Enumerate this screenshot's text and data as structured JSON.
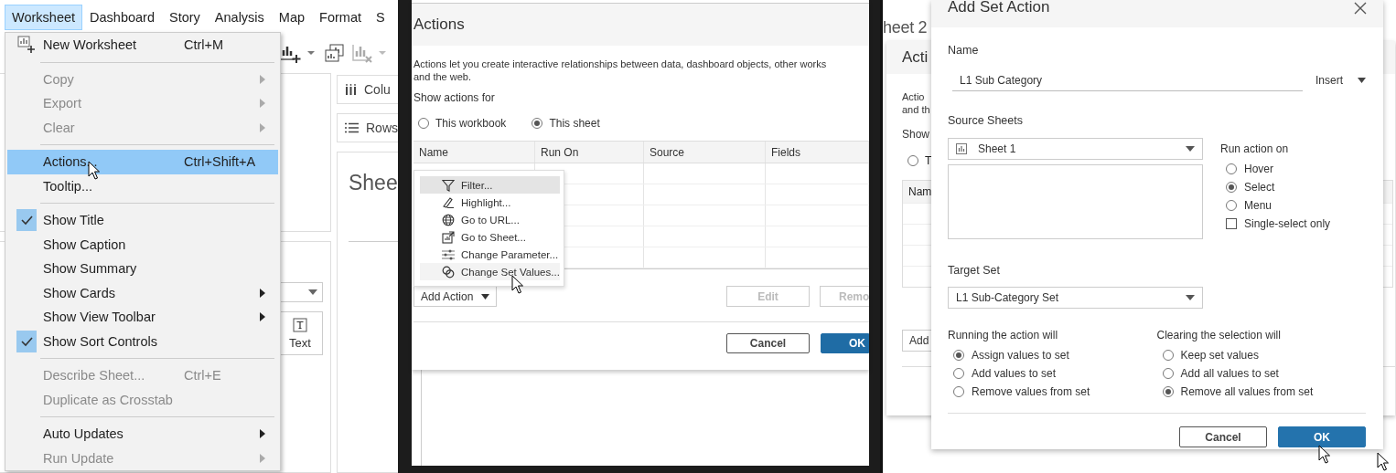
{
  "menubar": [
    {
      "label": "Worksheet",
      "selected": true
    },
    {
      "label": "Dashboard",
      "selected": false
    },
    {
      "label": "Story",
      "selected": false
    },
    {
      "label": "Analysis",
      "selected": false
    },
    {
      "label": "Map",
      "selected": false
    },
    {
      "label": "Format",
      "selected": false
    },
    {
      "label": "S",
      "selected": false
    }
  ],
  "workspace": {
    "columns_shelf": "Colu",
    "rows_shelf": "Rows",
    "sheet_title": "Shee",
    "marks_button": "Text"
  },
  "worksheet_menu": [
    {
      "kind": "icon_item",
      "label": "New Worksheet",
      "shortcut": "Ctrl+M",
      "disabled": false,
      "checked": false,
      "selected": false,
      "submenu": false
    },
    {
      "kind": "separator"
    },
    {
      "kind": "item",
      "label": "Copy",
      "disabled": true,
      "checked": false,
      "selected": false,
      "submenu": true
    },
    {
      "kind": "item",
      "label": "Export",
      "disabled": true,
      "checked": false,
      "selected": false,
      "submenu": true
    },
    {
      "kind": "item",
      "label": "Clear",
      "disabled": true,
      "checked": false,
      "selected": false,
      "submenu": true
    },
    {
      "kind": "separator"
    },
    {
      "kind": "item",
      "label": "Actions...",
      "shortcut": "Ctrl+Shift+A",
      "disabled": false,
      "checked": false,
      "selected": true,
      "submenu": false
    },
    {
      "kind": "item",
      "label": "Tooltip...",
      "disabled": false,
      "checked": false,
      "selected": false,
      "submenu": false
    },
    {
      "kind": "separator"
    },
    {
      "kind": "item",
      "label": "Show Title",
      "disabled": false,
      "checked": true,
      "selected": false,
      "submenu": false
    },
    {
      "kind": "item",
      "label": "Show Caption",
      "disabled": false,
      "checked": false,
      "selected": false,
      "submenu": false
    },
    {
      "kind": "item",
      "label": "Show Summary",
      "disabled": false,
      "checked": false,
      "selected": false,
      "submenu": false
    },
    {
      "kind": "item",
      "label": "Show Cards",
      "disabled": false,
      "checked": false,
      "selected": false,
      "submenu": true
    },
    {
      "kind": "item",
      "label": "Show View Toolbar",
      "disabled": false,
      "checked": false,
      "selected": false,
      "submenu": true
    },
    {
      "kind": "item",
      "label": "Show Sort Controls",
      "disabled": false,
      "checked": true,
      "selected": false,
      "submenu": false
    },
    {
      "kind": "separator"
    },
    {
      "kind": "item",
      "label": "Describe Sheet...",
      "shortcut": "Ctrl+E",
      "disabled": true,
      "checked": false,
      "selected": false,
      "submenu": false
    },
    {
      "kind": "item",
      "label": "Duplicate as Crosstab",
      "disabled": true,
      "checked": false,
      "selected": false,
      "submenu": false
    },
    {
      "kind": "separator"
    },
    {
      "kind": "item",
      "label": "Auto Updates",
      "disabled": false,
      "checked": false,
      "selected": false,
      "submenu": true
    },
    {
      "kind": "item",
      "label": "Run Update",
      "disabled": true,
      "checked": false,
      "selected": false,
      "submenu": true
    }
  ],
  "actions_dialog": {
    "title": "Actions",
    "description": "Actions let you create interactive relationships between data, dashboard objects, other works\nand the web.",
    "show_label": "Show actions for",
    "scope": [
      {
        "label": "This workbook",
        "selected": false
      },
      {
        "label": "This sheet",
        "selected": true
      }
    ],
    "columns": [
      "Name",
      "Run On",
      "Source",
      "Fields"
    ],
    "add_button": "Add Action",
    "add_menu": [
      {
        "kind": "filter",
        "label": "Filter...",
        "selected": true,
        "hovered": false
      },
      {
        "kind": "highlight",
        "label": "Highlight...",
        "selected": false,
        "hovered": false
      },
      {
        "kind": "url",
        "label": "Go to URL...",
        "selected": false,
        "hovered": false
      },
      {
        "kind": "sheet",
        "label": "Go to Sheet...",
        "selected": false,
        "hovered": false
      },
      {
        "kind": "parameter",
        "label": "Change Parameter...",
        "selected": false,
        "hovered": false
      },
      {
        "kind": "set",
        "label": "Change Set Values...",
        "selected": false,
        "hovered": true
      }
    ],
    "row_buttons": [
      {
        "label": "Edit",
        "disabled": true
      },
      {
        "label": "Remo",
        "disabled": true
      }
    ],
    "buttons": [
      {
        "label": "Cancel",
        "kind": "secondary"
      },
      {
        "label": "OK",
        "kind": "primary"
      }
    ]
  },
  "backdrop": {
    "sheet_title": "heet 2",
    "dialog_title": "Acti",
    "description": "Actio\nand th",
    "show_label": "Show",
    "radio": {
      "label": "T",
      "selected": false
    },
    "column": "Nam",
    "add_button": "Add"
  },
  "set_action_dialog": {
    "title": "Add Set Action",
    "name_label": "Name",
    "name_value": "L1 Sub Category",
    "insert_label": "Insert",
    "source_label": "Source Sheets",
    "source_sheet": "Sheet 1",
    "run_on_label": "Run action on",
    "run_on": [
      {
        "label": "Hover",
        "selected": false
      },
      {
        "label": "Select",
        "selected": true
      },
      {
        "label": "Menu",
        "selected": false
      }
    ],
    "single_select": {
      "label": "Single-select only",
      "checked": false
    },
    "target_label": "Target Set",
    "target_set": "L1 Sub-Category Set",
    "running_label": "Running the action will",
    "running": [
      {
        "label": "Assign values to set",
        "selected": true
      },
      {
        "label": "Add values to set",
        "selected": false
      },
      {
        "label": "Remove values from set",
        "selected": false
      }
    ],
    "clearing_label": "Clearing the selection will",
    "clearing": [
      {
        "label": "Keep set values",
        "selected": false
      },
      {
        "label": "Add all values to set",
        "selected": false
      },
      {
        "label": "Remove all values from set",
        "selected": true
      }
    ],
    "buttons": [
      {
        "label": "Cancel",
        "kind": "secondary"
      },
      {
        "label": "OK",
        "kind": "primary"
      }
    ]
  }
}
